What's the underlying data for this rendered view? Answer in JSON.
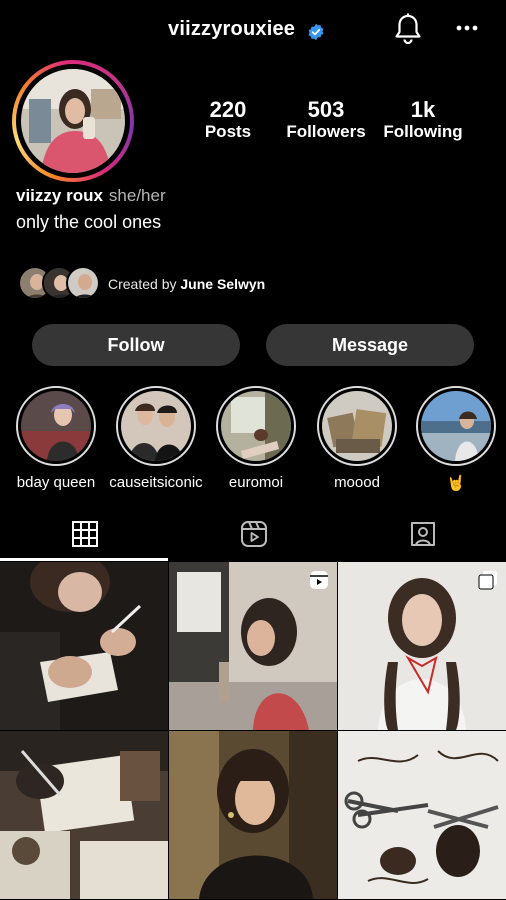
{
  "header": {
    "username": "viizzyrouxiee",
    "verified_icon": "verified-badge-icon",
    "notifications_icon": "bell-icon",
    "menu_icon": "more-dots-icon"
  },
  "profile": {
    "display_name": "viizzy roux",
    "pronouns": "she/her",
    "bio": "only the cool ones",
    "stats": {
      "posts": {
        "value": "220",
        "label": "Posts"
      },
      "followers": {
        "value": "503",
        "label": "Followers"
      },
      "following": {
        "value": "1k",
        "label": "Following"
      }
    }
  },
  "created_by": {
    "prefix": "Created by",
    "name": "June Selwyn"
  },
  "actions": {
    "follow": "Follow",
    "message": "Message"
  },
  "highlights": [
    {
      "label": "bday queen"
    },
    {
      "label": "causeitsiconic"
    },
    {
      "label": "euromoi"
    },
    {
      "label": "moood"
    },
    {
      "label": "🤘"
    }
  ],
  "tabs": [
    {
      "icon": "grid-icon",
      "active": true
    },
    {
      "icon": "reels-icon",
      "active": false
    },
    {
      "icon": "tagged-icon",
      "active": false
    }
  ],
  "posts": [
    {
      "badge": "none"
    },
    {
      "badge": "reel-icon"
    },
    {
      "badge": "carousel-icon"
    },
    {
      "badge": "none"
    },
    {
      "badge": "none"
    },
    {
      "badge": "none"
    }
  ],
  "colors": {
    "background": "#000000",
    "button": "#363636",
    "verified": "#3897f0"
  }
}
